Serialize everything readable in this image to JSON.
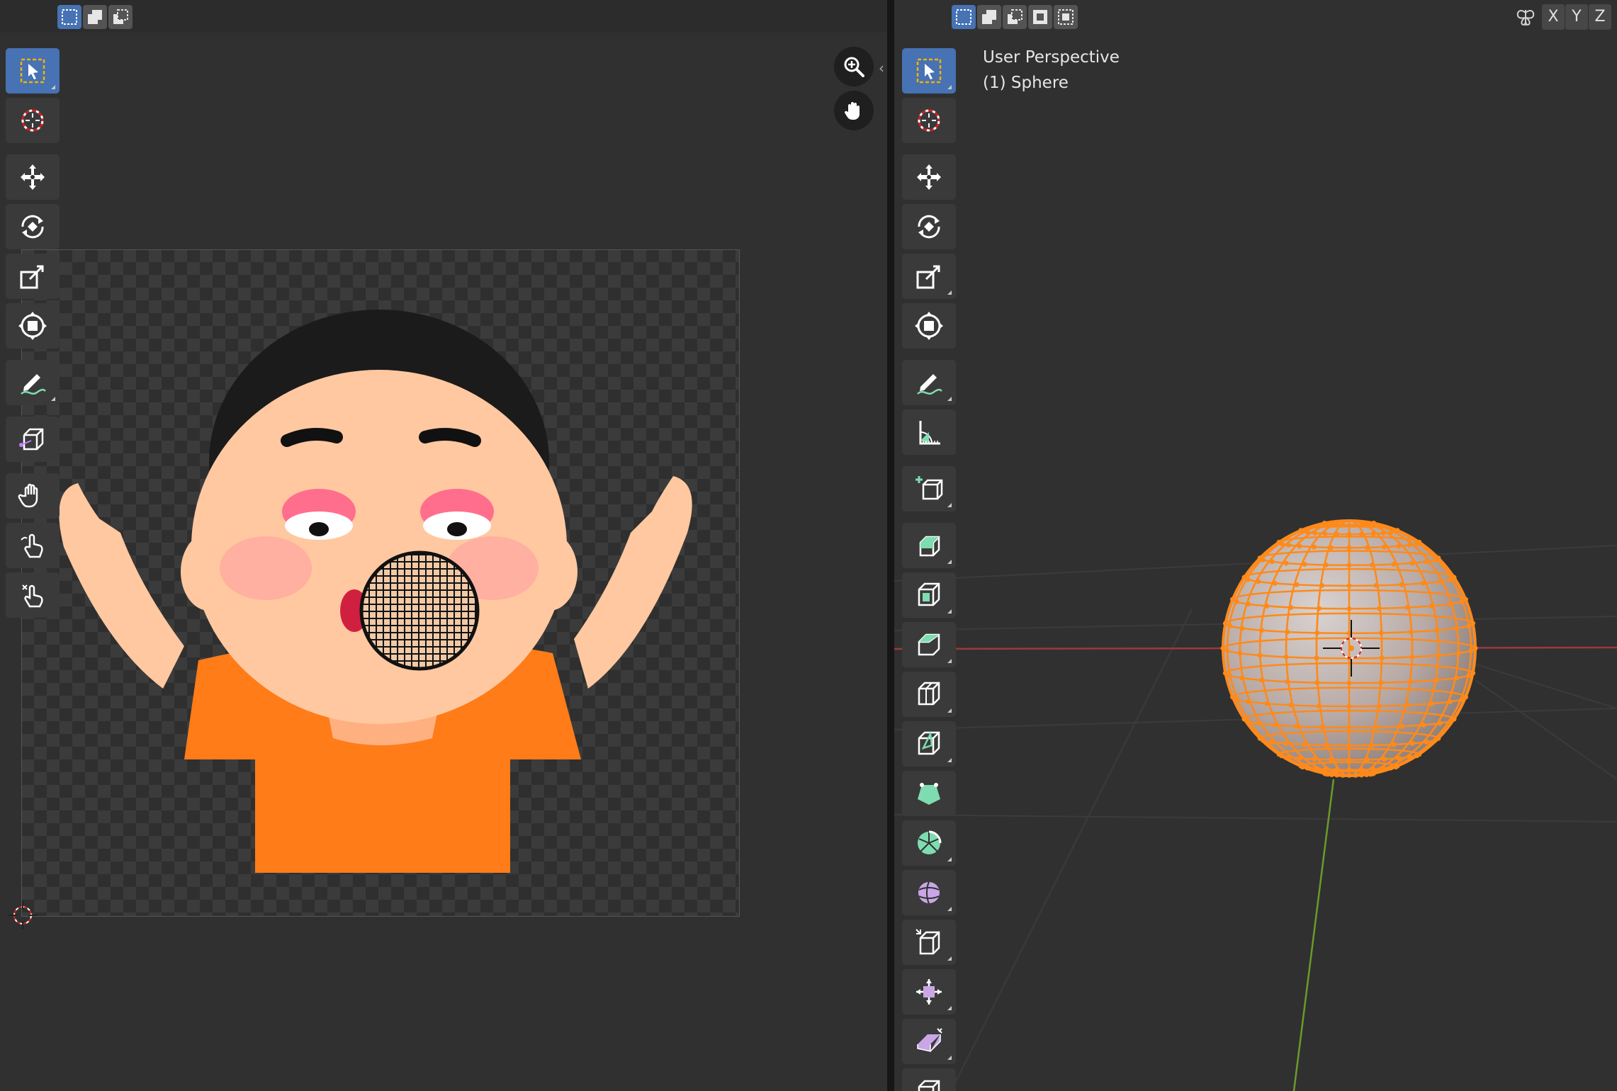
{
  "uv_editor": {
    "header": {
      "selection_modes": [
        {
          "icon": "select-box-new-icon",
          "active": true
        },
        {
          "icon": "select-box-extend-icon",
          "active": false
        },
        {
          "icon": "select-box-subtract-icon",
          "active": false
        }
      ]
    },
    "tools": [
      {
        "icon": "select-box-icon",
        "active": true
      },
      {
        "icon": "cursor-icon"
      },
      {
        "icon": "move-icon"
      },
      {
        "icon": "rotate-icon"
      },
      {
        "icon": "scale-icon"
      },
      {
        "icon": "transform-icon"
      },
      {
        "icon": "annotate-icon"
      },
      {
        "icon": "rip-region-icon"
      },
      {
        "icon": "grab-icon"
      },
      {
        "icon": "relax-icon"
      },
      {
        "icon": "pinch-icon"
      }
    ],
    "navigation": [
      "zoom-icon",
      "pan-hand-icon"
    ],
    "image": {
      "subject": "cartoon boy with raised arms and open mouth, orange shirt"
    }
  },
  "viewport": {
    "header": {
      "selection_modes": [
        {
          "icon": "select-box-new-icon",
          "active": true
        },
        {
          "icon": "select-box-extend-icon",
          "active": false
        },
        {
          "icon": "select-box-subtract-icon",
          "active": false
        },
        {
          "icon": "select-box-difference-icon",
          "active": false
        },
        {
          "icon": "select-box-intersect-icon",
          "active": false
        }
      ],
      "mirror_axes": [
        "X",
        "Y",
        "Z"
      ]
    },
    "info": {
      "view_name": "User Perspective",
      "object_name": "(1) Sphere"
    },
    "tools": [
      {
        "icon": "select-box-icon",
        "active": true
      },
      {
        "icon": "cursor-icon"
      },
      {
        "icon": "move-icon"
      },
      {
        "icon": "rotate-icon"
      },
      {
        "icon": "scale-icon"
      },
      {
        "icon": "transform-icon"
      },
      {
        "icon": "annotate-icon"
      },
      {
        "icon": "measure-icon"
      },
      {
        "icon": "add-cube-icon"
      },
      {
        "icon": "extrude-region-icon"
      },
      {
        "icon": "inset-faces-icon"
      },
      {
        "icon": "bevel-icon"
      },
      {
        "icon": "loop-cut-icon"
      },
      {
        "icon": "knife-icon"
      },
      {
        "icon": "poly-build-icon"
      },
      {
        "icon": "spin-icon"
      },
      {
        "icon": "smooth-icon"
      },
      {
        "icon": "edge-slide-icon"
      },
      {
        "icon": "shrink-fatten-icon"
      },
      {
        "icon": "shear-icon"
      },
      {
        "icon": "to-sphere-icon"
      }
    ],
    "colors": {
      "selection": "#ff8a1a",
      "x_axis": "#9b3a3a",
      "y_axis": "#6a9a2a",
      "active_tool": "#4772b3"
    }
  }
}
